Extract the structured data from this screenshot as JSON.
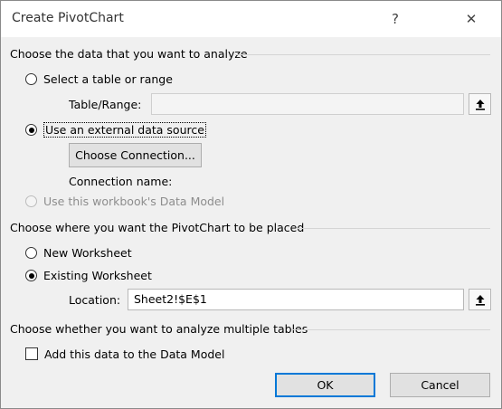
{
  "dialog": {
    "title": "Create PivotChart",
    "help_glyph": "?",
    "close_glyph": "✕"
  },
  "section_data": {
    "heading": "Choose the data that you want to analyze",
    "option_table": "Select a table or range",
    "table_range_label": "Table/Range:",
    "table_range_value": "",
    "option_external": "Use an external data source",
    "choose_connection_button": "Choose Connection...",
    "connection_name_label": "Connection name:",
    "option_data_model": "Use this workbook's Data Model"
  },
  "section_place": {
    "heading": "Choose where you want the PivotChart to be placed",
    "option_new": "New Worksheet",
    "option_existing": "Existing Worksheet",
    "location_label": "Location:",
    "location_value": "Sheet2!$E$1"
  },
  "section_multi": {
    "heading": "Choose whether you want to analyze multiple tables",
    "add_to_model": "Add this data to the Data Model"
  },
  "buttons": {
    "ok": "OK",
    "cancel": "Cancel"
  },
  "icons": {
    "collapse": "collapse-dialog-icon"
  },
  "colors": {
    "default_button_border": "#0078d7",
    "dialog_bg": "#f0f0f0"
  }
}
